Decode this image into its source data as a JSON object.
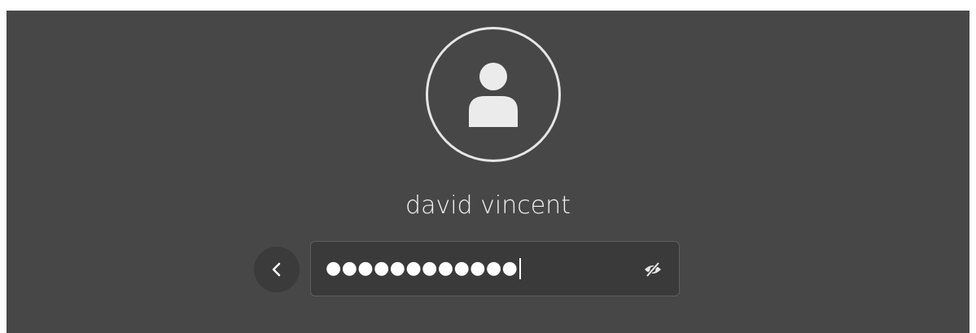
{
  "user": {
    "name": "david vincent",
    "avatar_icon": "user-avatar-icon"
  },
  "password": {
    "masked_value": "●●●●●●●●●●●●",
    "reveal_icon": "eye-hidden-icon"
  },
  "navigation": {
    "back_icon": "chevron-left-icon"
  },
  "colors": {
    "background": "#474747",
    "field_background": "#3a3a3a",
    "text": "#f2f2f2"
  }
}
